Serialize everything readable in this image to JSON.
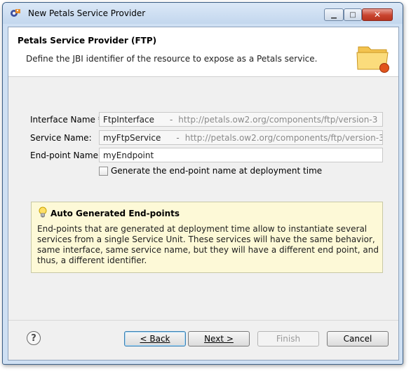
{
  "window": {
    "title": "New Petals Service Provider",
    "controls": {
      "minimize_icon": "minimize-icon",
      "maximize_icon": "maximize-icon",
      "close_icon": "close-icon"
    }
  },
  "banner": {
    "title": "Petals Service Provider (FTP)",
    "description": "Define the JBI identifier of the resource to expose as a Petals service.",
    "icon": "folder-icon"
  },
  "form": {
    "interface_label": "Interface Name *:",
    "interface_value": "FtpInterface",
    "interface_sep": "-",
    "interface_ns": "http://petals.ow2.org/components/ftp/version-3",
    "service_label": "Service Name:",
    "service_value": "myFtpService",
    "service_sep": "-",
    "service_ns": "http://petals.ow2.org/components/ftp/version-3",
    "endpoint_label": "End-point Name:",
    "endpoint_value": "myEndpoint",
    "generate_label": "Generate the end-point name at deployment time",
    "generate_checked": false
  },
  "info": {
    "icon": "lightbulb-icon",
    "title": "Auto Generated End-points",
    "text": "End-points that are generated at deployment time allow to instantiate several services from a single Service Unit. These services will have the same behavior, same interface, same service name, but they will have a different end point, and thus, a different identifier."
  },
  "buttons": {
    "help": "?",
    "back": "< Back",
    "next": "Next >",
    "finish": "Finish",
    "cancel": "Cancel"
  }
}
